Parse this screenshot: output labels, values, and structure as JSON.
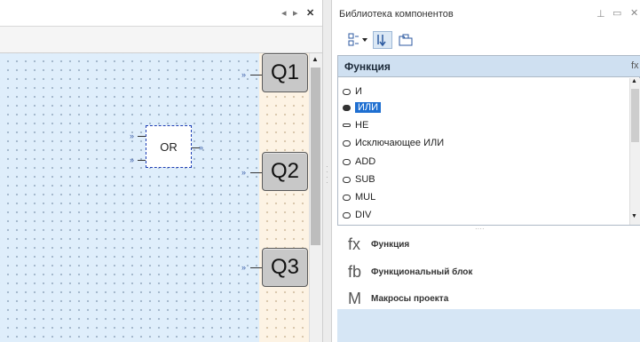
{
  "editor": {
    "tab_controls": {
      "prev": "◂",
      "next": "▸",
      "close": "✕"
    },
    "outputs": [
      "Q1",
      "Q2",
      "Q3"
    ],
    "block": {
      "label": "OR"
    },
    "colors": {
      "canvas": "#dfeefb",
      "output_strip": "#fdf3e4",
      "selection": "#1e3fb4"
    }
  },
  "library": {
    "title": "Библиотека компонентов",
    "window_controls": {
      "pin": "⊥",
      "maximize": "▭",
      "close": "✕"
    },
    "toolbar": {
      "view_icon": "list-view-icon",
      "sort_icon": "sort-icon",
      "folder_icon": "folder-icon"
    },
    "list": {
      "header": "Функция",
      "header_corner": "fx",
      "items": [
        "И",
        "ИЛИ",
        "НЕ",
        "Исключающее ИЛИ",
        "ADD",
        "SUB",
        "MUL",
        "DIV"
      ],
      "selected": "ИЛИ"
    },
    "categories": [
      {
        "icon": "fx",
        "label": "Функция"
      },
      {
        "icon": "fb",
        "label": "Функциональный блок"
      },
      {
        "icon": "M",
        "label": "Макросы проекта"
      }
    ],
    "colors": {
      "header": "#cfe0f1",
      "selected": "#1f6fd1",
      "bottom_band": "#d6e6f5"
    }
  }
}
